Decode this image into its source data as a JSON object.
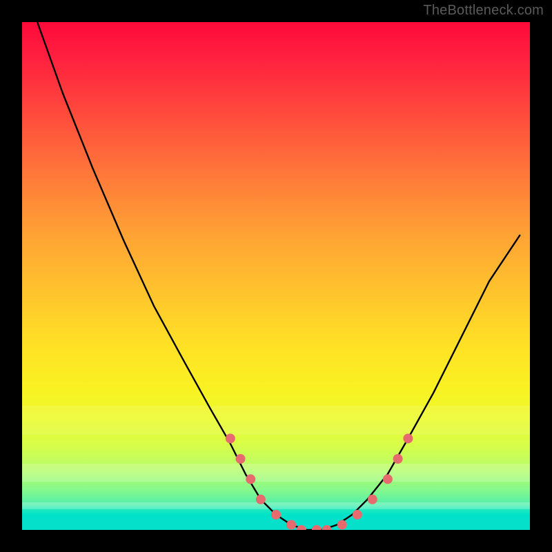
{
  "watermark": "TheBottleneck.com",
  "colors": {
    "background": "#000000",
    "curve": "#000000",
    "dot": "#e66a6e",
    "gradient_top": "#ff0a3a",
    "gradient_mid": "#ffe225",
    "gradient_bottom": "#04e0ca"
  },
  "chart_data": {
    "type": "line",
    "title": "",
    "xlabel": "",
    "ylabel": "",
    "xlim": [
      0,
      100
    ],
    "ylim": [
      0,
      100
    ],
    "legend": false,
    "grid": false,
    "series": [
      {
        "name": "bottleneck-curve",
        "x": [
          3,
          8,
          14,
          20,
          26,
          32,
          37,
          41,
          44,
          47,
          50,
          53,
          56,
          59,
          62,
          65,
          68,
          72,
          76,
          81,
          86,
          92,
          98
        ],
        "values": [
          100,
          86,
          71,
          57,
          44,
          33,
          24,
          17,
          11,
          6,
          3,
          1,
          0,
          0,
          1,
          3,
          6,
          11,
          18,
          27,
          37,
          49,
          58
        ]
      }
    ],
    "markers": {
      "name": "highlight-dots",
      "x": [
        41,
        43,
        45,
        47,
        50,
        53,
        55,
        58,
        60,
        63,
        66,
        69,
        72,
        74,
        76
      ],
      "values": [
        18,
        14,
        10,
        6,
        3,
        1,
        0,
        0,
        0,
        1,
        3,
        6,
        10,
        14,
        18
      ]
    }
  }
}
